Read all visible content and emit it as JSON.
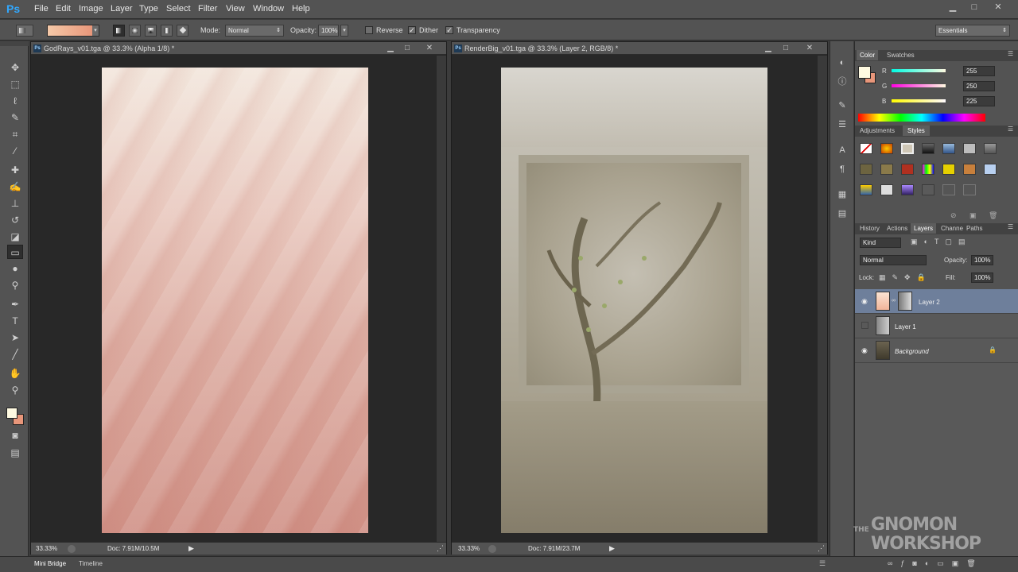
{
  "app": {
    "logo": "Ps"
  },
  "menu": [
    "File",
    "Edit",
    "Image",
    "Layer",
    "Type",
    "Select",
    "Filter",
    "View",
    "Window",
    "Help"
  ],
  "window_controls": {
    "minimize": "▁",
    "maximize": "□",
    "close": "✕"
  },
  "options": {
    "mode_label": "Mode:",
    "mode_value": "Normal",
    "opacity_label": "Opacity:",
    "opacity_value": "100%",
    "reverse_label": "Reverse",
    "dither_label": "Dither",
    "transparency_label": "Transparency",
    "workspace": "Essentials",
    "gradient_colors": [
      "#f5c9a8",
      "#e8967a"
    ]
  },
  "docs": [
    {
      "title": "GodRays_v01.tga @ 33.3% (Alpha 1/8) *",
      "zoom": "33.33%",
      "doc_info": "Doc: 7.91M/10.5M"
    },
    {
      "title": "RenderBig_v01.tga @ 33.3% (Layer 2, RGB/8) *",
      "zoom": "33.33%",
      "doc_info": "Doc: 7.91M/23.7M"
    }
  ],
  "color_panel": {
    "tabs": [
      "Color",
      "Swatches"
    ],
    "r_label": "R",
    "r_value": "255",
    "g_label": "G",
    "g_value": "250",
    "b_label": "B",
    "b_value": "225",
    "foreground": "#fffae1",
    "background": "#e8967a"
  },
  "styles_panel": {
    "tabs": [
      "Adjustments",
      "Styles"
    ]
  },
  "layers_panel": {
    "tabs": [
      "History",
      "Actions",
      "Layers",
      "Channe",
      "Paths"
    ],
    "kind_label": "Kind",
    "blend_mode": "Normal",
    "opacity_label": "Opacity:",
    "opacity_value": "100%",
    "lock_label": "Lock:",
    "fill_label": "Fill:",
    "fill_value": "100%",
    "layers": [
      {
        "name": "Layer 2",
        "visible": true,
        "selected": true
      },
      {
        "name": "Layer 1",
        "visible": false,
        "selected": false
      },
      {
        "name": "Background",
        "visible": true,
        "selected": false
      }
    ]
  },
  "bottom_tabs": [
    "Mini Bridge",
    "Timeline"
  ],
  "watermark": {
    "line1": "THE",
    "line2": "GNOMON",
    "line3": "WORKSHOP"
  }
}
